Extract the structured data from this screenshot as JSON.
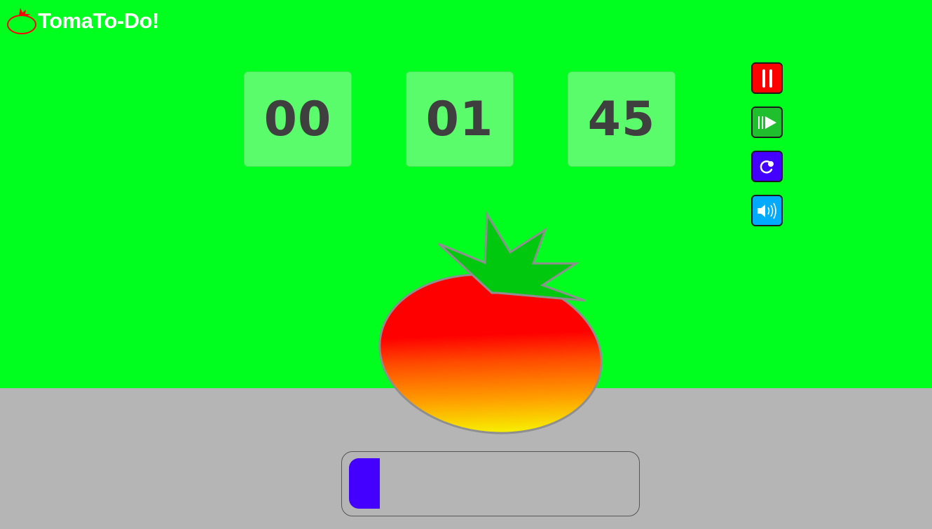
{
  "app": {
    "title": "TomaTo-Do!",
    "logo_icon": "tomato-outline-icon",
    "logo_color": "#ff0000"
  },
  "colors": {
    "background": "#00ff1e",
    "floor": "#b5b5b5",
    "timer_box": "#5bfc6b",
    "digits": "#3f3f3f",
    "progress_fill": "#4400ff"
  },
  "timer": {
    "hours": "00",
    "minutes": "01",
    "seconds": "45"
  },
  "controls": [
    {
      "name": "pause",
      "icon": "pause-icon",
      "color": "#ff0000"
    },
    {
      "name": "skip",
      "icon": "skip-forward-icon",
      "color": "#1fbf2d"
    },
    {
      "name": "reset",
      "icon": "refresh-icon",
      "color": "#4400ff"
    },
    {
      "name": "sound",
      "icon": "volume-icon",
      "color": "#00aaff"
    }
  ],
  "tomato": {
    "icon": "tomato-illustration"
  },
  "progress": {
    "fraction": 0.11
  }
}
